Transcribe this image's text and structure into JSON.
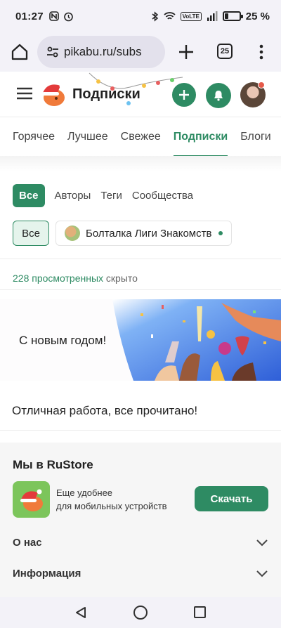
{
  "status_bar": {
    "time": "01:27",
    "battery_percent": "25 %",
    "battery_level": 0.25,
    "network_badge": "VoLTE"
  },
  "browser": {
    "url": "pikabu.ru/subs",
    "tab_count": "25"
  },
  "site_header": {
    "title": "Подписки"
  },
  "nav_tabs": [
    {
      "label": "Горячее",
      "active": false
    },
    {
      "label": "Лучшее",
      "active": false
    },
    {
      "label": "Свежее",
      "active": false
    },
    {
      "label": "Подписки",
      "active": true
    },
    {
      "label": "Блоги",
      "active": false
    }
  ],
  "filters": {
    "all": "Все",
    "authors": "Авторы",
    "tags": "Теги",
    "communities": "Сообщества"
  },
  "subfilter": {
    "all": "Все",
    "community": "Болталка Лиги Знакомств"
  },
  "viewed": {
    "link": "228 просмотренных",
    "suffix": " скрыто"
  },
  "banner": {
    "text": "С новым годом!"
  },
  "all_read": "Отличная работа, все прочитано!",
  "footer": {
    "title": "Мы в RuStore",
    "app_desc_line1": "Еще удобнее",
    "app_desc_line2": "для мобильных устройств",
    "download_label": "Скачать",
    "about": "О нас",
    "info": "Информация"
  },
  "colors": {
    "accent": "#2e8b63",
    "accent_light": "#e5f4ec",
    "browser_bg": "#f3f2f8"
  }
}
